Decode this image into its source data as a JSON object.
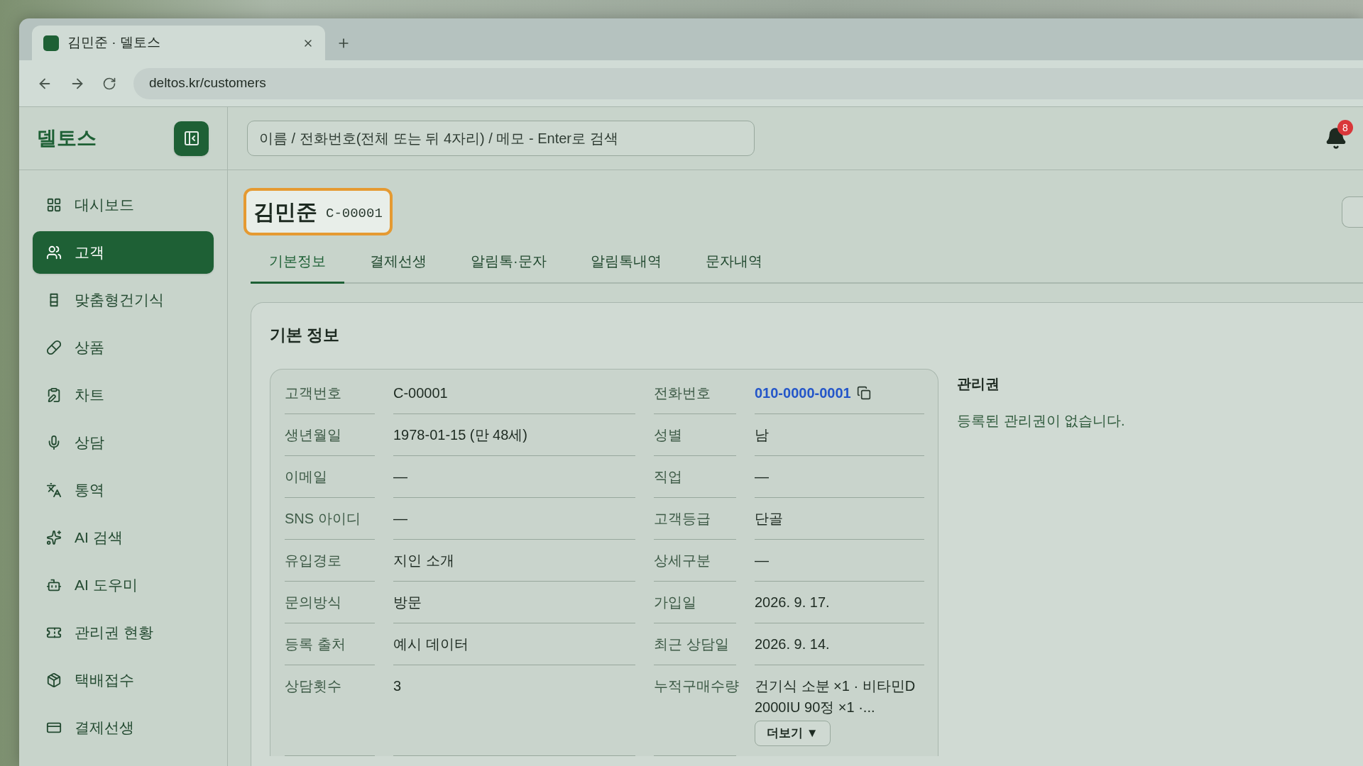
{
  "browser": {
    "tab": {
      "title": "김민준 · 델토스",
      "selected": true
    },
    "url": "deltos.kr/customers"
  },
  "sidebar": {
    "logo": "델토스",
    "items": [
      {
        "label": "대시보드",
        "selected": false
      },
      {
        "label": "고객",
        "selected": true
      },
      {
        "label": "맞춤형건기식",
        "selected": false
      },
      {
        "label": "상품",
        "selected": false
      },
      {
        "label": "차트",
        "selected": false
      },
      {
        "label": "상담",
        "selected": false
      },
      {
        "label": "통역",
        "selected": false
      },
      {
        "label": "AI 검색",
        "selected": false
      },
      {
        "label": "AI 도우미",
        "selected": false
      },
      {
        "label": "관리권 현황",
        "selected": false
      },
      {
        "label": "택배접수",
        "selected": false
      },
      {
        "label": "결제선생",
        "selected": false
      }
    ]
  },
  "header": {
    "search": {
      "placeholder": "이름 / 전화번호(전체 또는 뒤 4자리) / 메모 - Enter로 검색"
    },
    "notifications": {
      "count": "8"
    }
  },
  "customer": {
    "name": "김민준",
    "code": "C-00001"
  },
  "tabs": [
    {
      "label": "기본정보",
      "selected": true
    },
    {
      "label": "결제선생",
      "selected": false
    },
    {
      "label": "알림톡·문자",
      "selected": false
    },
    {
      "label": "알림톡내역",
      "selected": false
    },
    {
      "label": "문자내역",
      "selected": false
    }
  ],
  "basic_info": {
    "title": "기본 정보",
    "rows": [
      {
        "fields": [
          {
            "label": "고객번호",
            "value": "C-00001",
            "kind": "text"
          },
          {
            "label": "전화번호",
            "value": "010-0000-0001",
            "kind": "phone"
          }
        ]
      },
      {
        "fields": [
          {
            "label": "생년월일",
            "value": "1978-01-15 (만 48세)",
            "kind": "text"
          },
          {
            "label": "성별",
            "value": "남",
            "kind": "text"
          }
        ]
      },
      {
        "fields": [
          {
            "label": "이메일",
            "value": "—",
            "kind": "text"
          },
          {
            "label": "직업",
            "value": "—",
            "kind": "text"
          }
        ]
      },
      {
        "fields": [
          {
            "label": "SNS 아이디",
            "value": "—",
            "kind": "text"
          },
          {
            "label": "고객등급",
            "value": "단골",
            "kind": "text"
          }
        ]
      },
      {
        "fields": [
          {
            "label": "유입경로",
            "value": "지인 소개",
            "kind": "text"
          },
          {
            "label": "상세구분",
            "value": "—",
            "kind": "text"
          }
        ]
      },
      {
        "fields": [
          {
            "label": "문의방식",
            "value": "방문",
            "kind": "text"
          },
          {
            "label": "가입일",
            "value": "2026. 9. 17.",
            "kind": "text"
          }
        ]
      },
      {
        "fields": [
          {
            "label": "등록 출처",
            "value": "예시 데이터",
            "kind": "text"
          },
          {
            "label": "최근 상담일",
            "value": "2026. 9. 14.",
            "kind": "text"
          }
        ]
      },
      {
        "fields": [
          {
            "label": "상담횟수",
            "value": "3",
            "kind": "text"
          },
          {
            "label": "누적구매수량",
            "value": "건기식 소분 ×1 · 비타민D 2000IU 90정 ×1 ·...",
            "kind": "long",
            "more": "더보기 ▼"
          }
        ]
      }
    ]
  },
  "membership": {
    "title": "관리권",
    "empty_text": "등록된 관리권이 없습니다."
  }
}
